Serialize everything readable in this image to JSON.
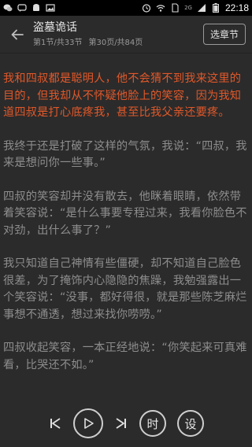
{
  "status_bar": {
    "time": "22:18",
    "network_label": "2G",
    "icons": [
      "wechat-icon",
      "chat-icon",
      "android-icon",
      "image-icon",
      "alarm-icon",
      "wifi-icon",
      "sim-icon",
      "signal-icon",
      "battery-icon"
    ]
  },
  "header": {
    "book_title": "盗墓诡话",
    "section_info": "第1节/共33节",
    "page_info": "第30页/共84页",
    "chapter_button": "选章节"
  },
  "content": {
    "paragraphs": [
      {
        "text": "我和四叔都是聪明人，他不会猜不到我来这里的目的，但我却从不怀疑他脸上的笑容，因为我知道四叔是打心底疼我，甚至比我父亲还要疼。",
        "highlighted": true
      },
      {
        "text": "我终于还是打破了这样的气氛，我说：“四叔，我来是想问你一些事。”",
        "highlighted": false
      },
      {
        "text": "四叔的笑容却并没有散去，他眯着眼睛，依然带着笑容说：“是什么事要专程过来，我看你脸色不对劲，出什么事了？”",
        "highlighted": false
      },
      {
        "text": "我只知道自己神情有些僵硬，却不知道自己脸色很差，为了掩饰内心隐隐的焦躁，我勉强露出一个笑容说：“没事，都好得很，就是那些陈芝麻烂事想不通透，想过来找你唠唠。”",
        "highlighted": false
      },
      {
        "text": "四叔收起笑容，一本正经地说：“你笑起来可真难看，比哭还不如。”",
        "highlighted": false
      }
    ]
  },
  "controls": {
    "time_label": "时",
    "settings_label": "设"
  },
  "colors": {
    "background": "#2b2b2b",
    "highlight": "#e0582a",
    "text": "#8d8d8d"
  }
}
